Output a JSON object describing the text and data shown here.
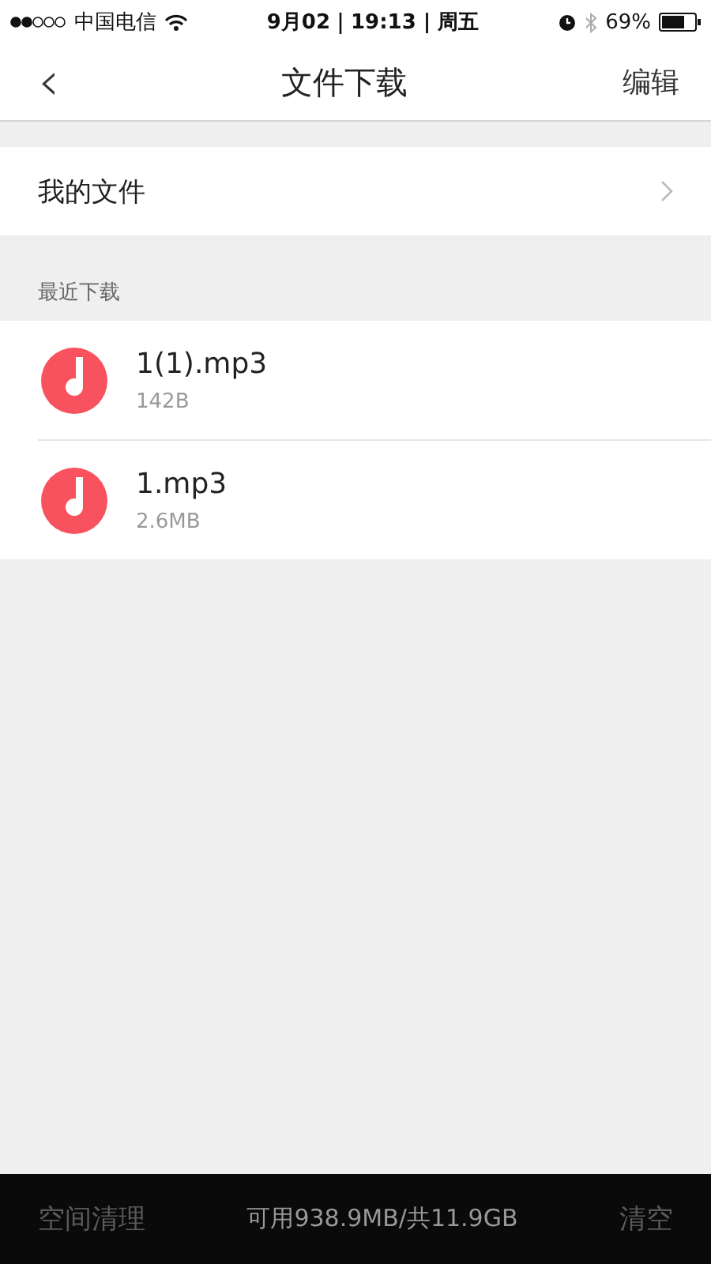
{
  "status_bar": {
    "carrier": "中国电信",
    "time": "9月02｜19:13 | 周五",
    "battery": "69%"
  },
  "nav": {
    "back": "‹",
    "title": "文件下载",
    "action": "编辑"
  },
  "my_files": {
    "label": "我的文件"
  },
  "recent": {
    "header": "最近下载",
    "files": [
      {
        "name": "1(1).mp3",
        "size": "142B"
      },
      {
        "name": "1.mp3",
        "size": "2.6MB"
      }
    ]
  },
  "bottom_bar": {
    "clean": {
      "label": "空间清理",
      "disabled": true
    },
    "storage": "可用938.9MB/共11.9GB",
    "clear": {
      "label": "清空",
      "disabled": true
    }
  }
}
